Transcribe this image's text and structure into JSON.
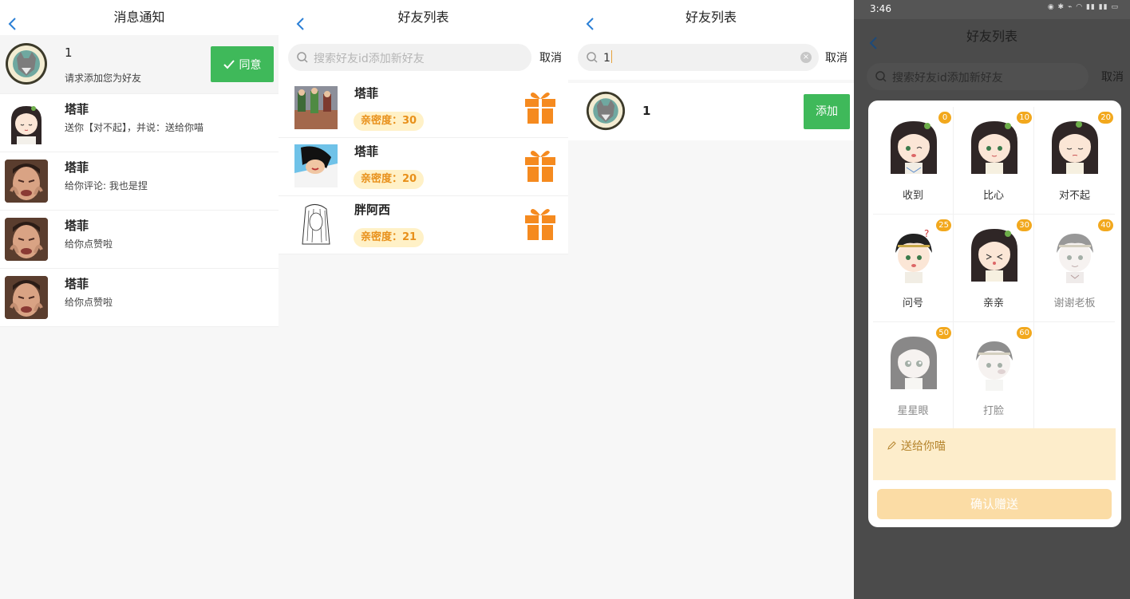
{
  "panel1": {
    "title": "消息通知",
    "messages": [
      {
        "name": "1",
        "text": "请求添加您为好友",
        "button": "同意"
      },
      {
        "name": "塔菲",
        "text": "送你【对不起】，并说：送给你喵"
      },
      {
        "name": "塔菲",
        "text": "给你评论: 我也是捏"
      },
      {
        "name": "塔菲",
        "text": "给你点赞啦"
      },
      {
        "name": "塔菲",
        "text": "给你点赞啦"
      }
    ]
  },
  "panel2": {
    "title": "好友列表",
    "search_placeholder": "搜索好友id添加新好友",
    "cancel": "取消",
    "friends": [
      {
        "name": "塔菲",
        "intimacy": "亲密度：30"
      },
      {
        "name": "塔菲",
        "intimacy": "亲密度：20"
      },
      {
        "name": "胖阿西",
        "intimacy": "亲密度：21"
      }
    ]
  },
  "panel3": {
    "title": "好友列表",
    "search_value": "1",
    "cancel": "取消",
    "result_name": "1",
    "add_button": "添加"
  },
  "panel4": {
    "status_time": "3:46",
    "title": "好友列表",
    "search_placeholder": "搜索好友id添加新好友",
    "cancel": "取消",
    "gifts": [
      {
        "label": "收到",
        "cost": "0"
      },
      {
        "label": "比心",
        "cost": "10"
      },
      {
        "label": "对不起",
        "cost": "20"
      },
      {
        "label": "问号",
        "cost": "25"
      },
      {
        "label": "亲亲",
        "cost": "30"
      },
      {
        "label": "谢谢老板",
        "cost": "40"
      },
      {
        "label": "星星眼",
        "cost": "50"
      },
      {
        "label": "打脸",
        "cost": "60"
      }
    ],
    "message": "送给你喵",
    "confirm": "确认赠送"
  },
  "colors": {
    "accent_green": "#3fb95a",
    "gift_orange": "#f58a1f",
    "badge_yellow": "#f2a81d"
  }
}
